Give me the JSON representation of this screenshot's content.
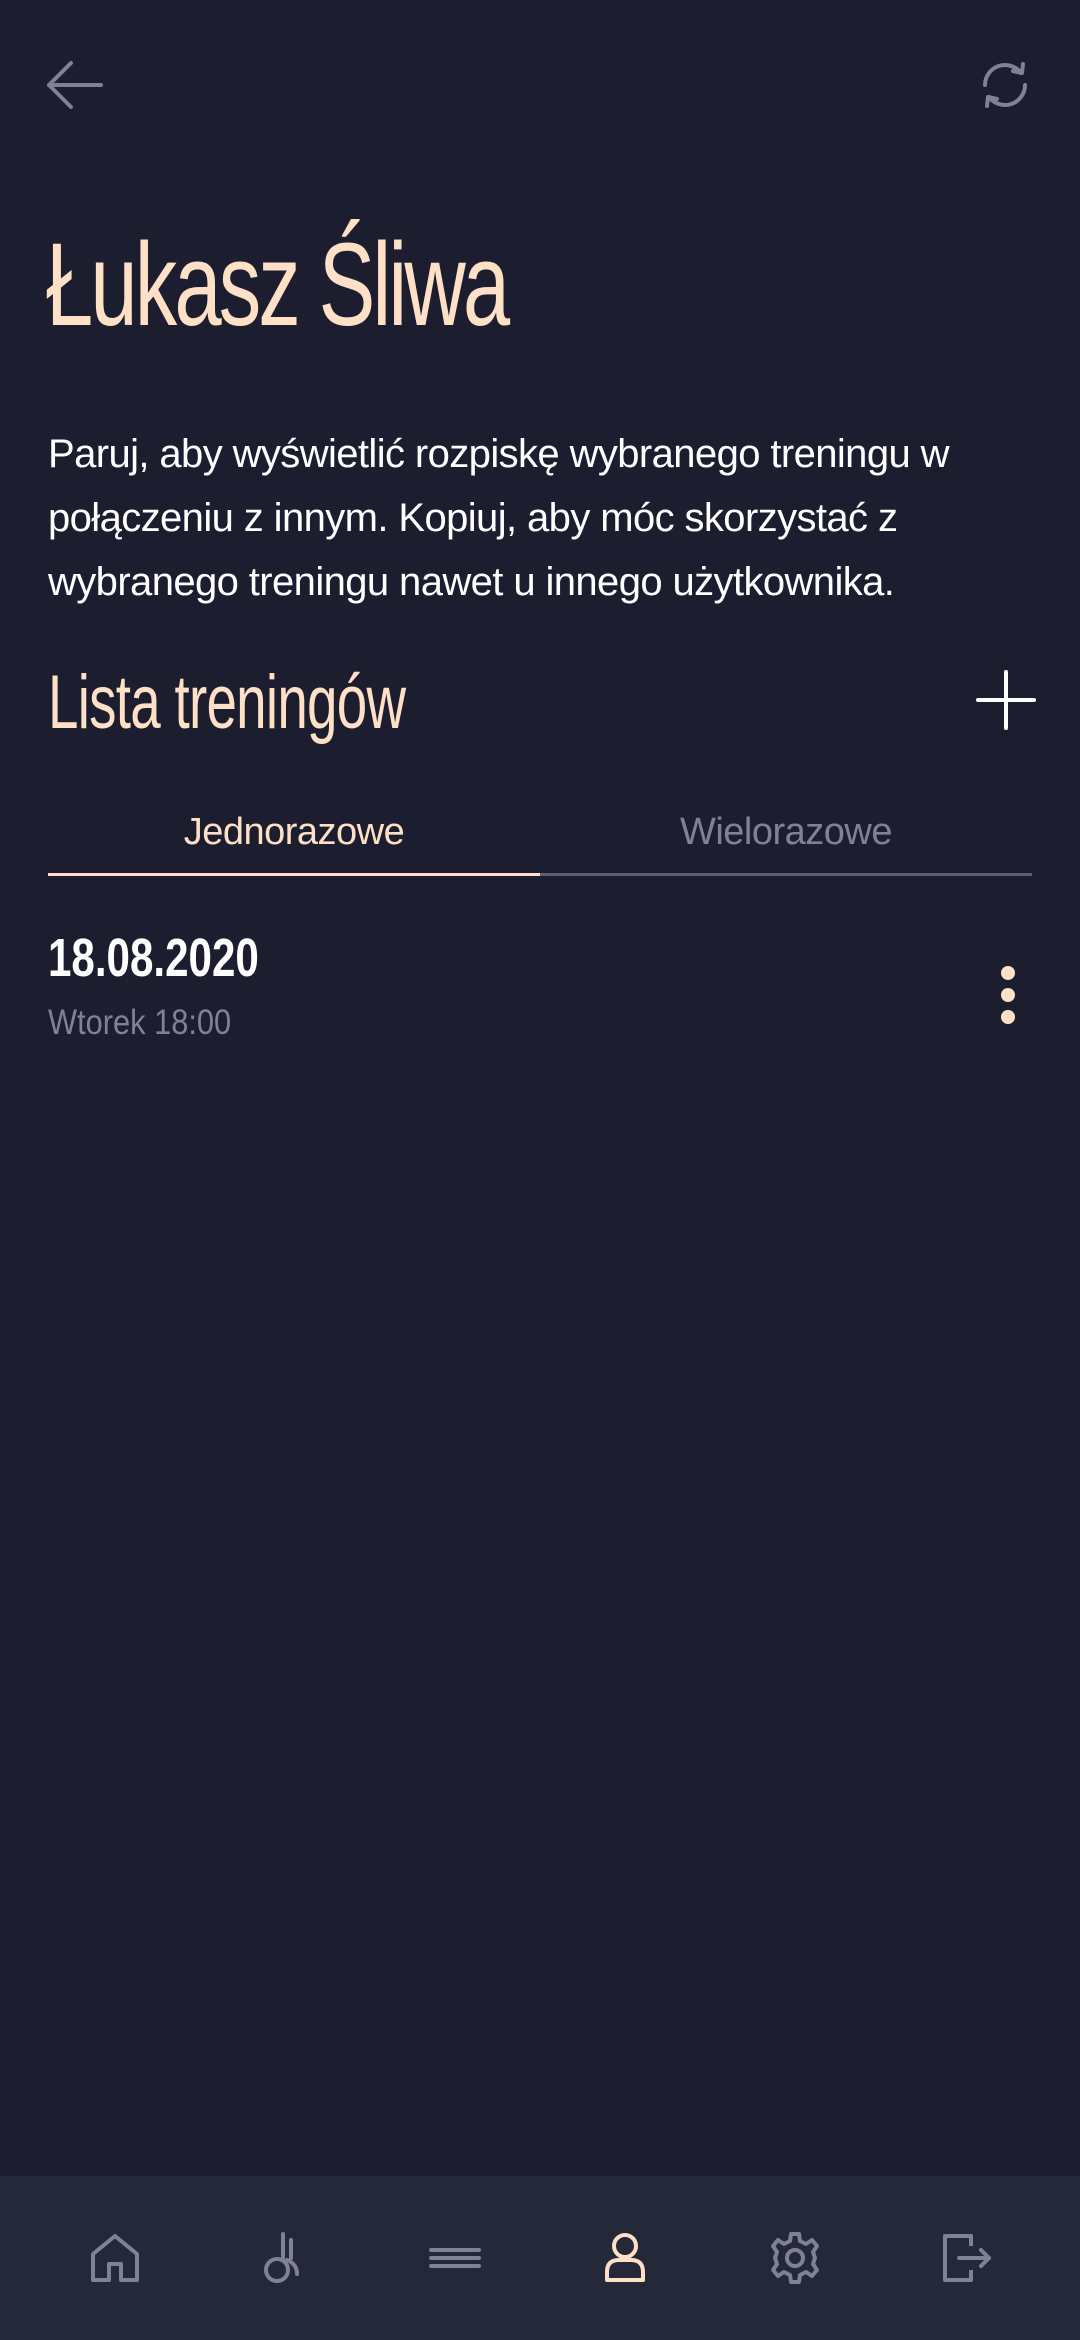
{
  "header": {
    "back_icon": "arrow-left-icon",
    "refresh_icon": "refresh-icon"
  },
  "profile": {
    "name": "Łukasz Śliwa",
    "description": "Paruj, aby wyświetlić rozpiskę wybranego treningu w połączeniu z innym. Kopiuj, aby móc skorzystać z wybranego treningu nawet u innego użytkownika."
  },
  "training_list": {
    "title": "Lista treningów",
    "add_icon": "plus-icon",
    "tabs": [
      {
        "label": "Jednorazowe",
        "active": true
      },
      {
        "label": "Wielorazowe",
        "active": false
      }
    ],
    "items": [
      {
        "date": "18.08.2020",
        "time": "Wtorek 18:00",
        "menu_icon": "more-vertical-icon"
      }
    ]
  },
  "bottom_nav": {
    "items": [
      {
        "icon": "home-icon",
        "active": false
      },
      {
        "icon": "kettlebell-icon",
        "active": false
      },
      {
        "icon": "menu-lines-icon",
        "active": false
      },
      {
        "icon": "user-icon",
        "active": true
      },
      {
        "icon": "gear-icon",
        "active": false
      },
      {
        "icon": "logout-icon",
        "active": false
      }
    ]
  },
  "colors": {
    "background": "#1c1e30",
    "accent": "#fde0c6",
    "muted": "#7f8296",
    "nav_background": "#252838"
  }
}
